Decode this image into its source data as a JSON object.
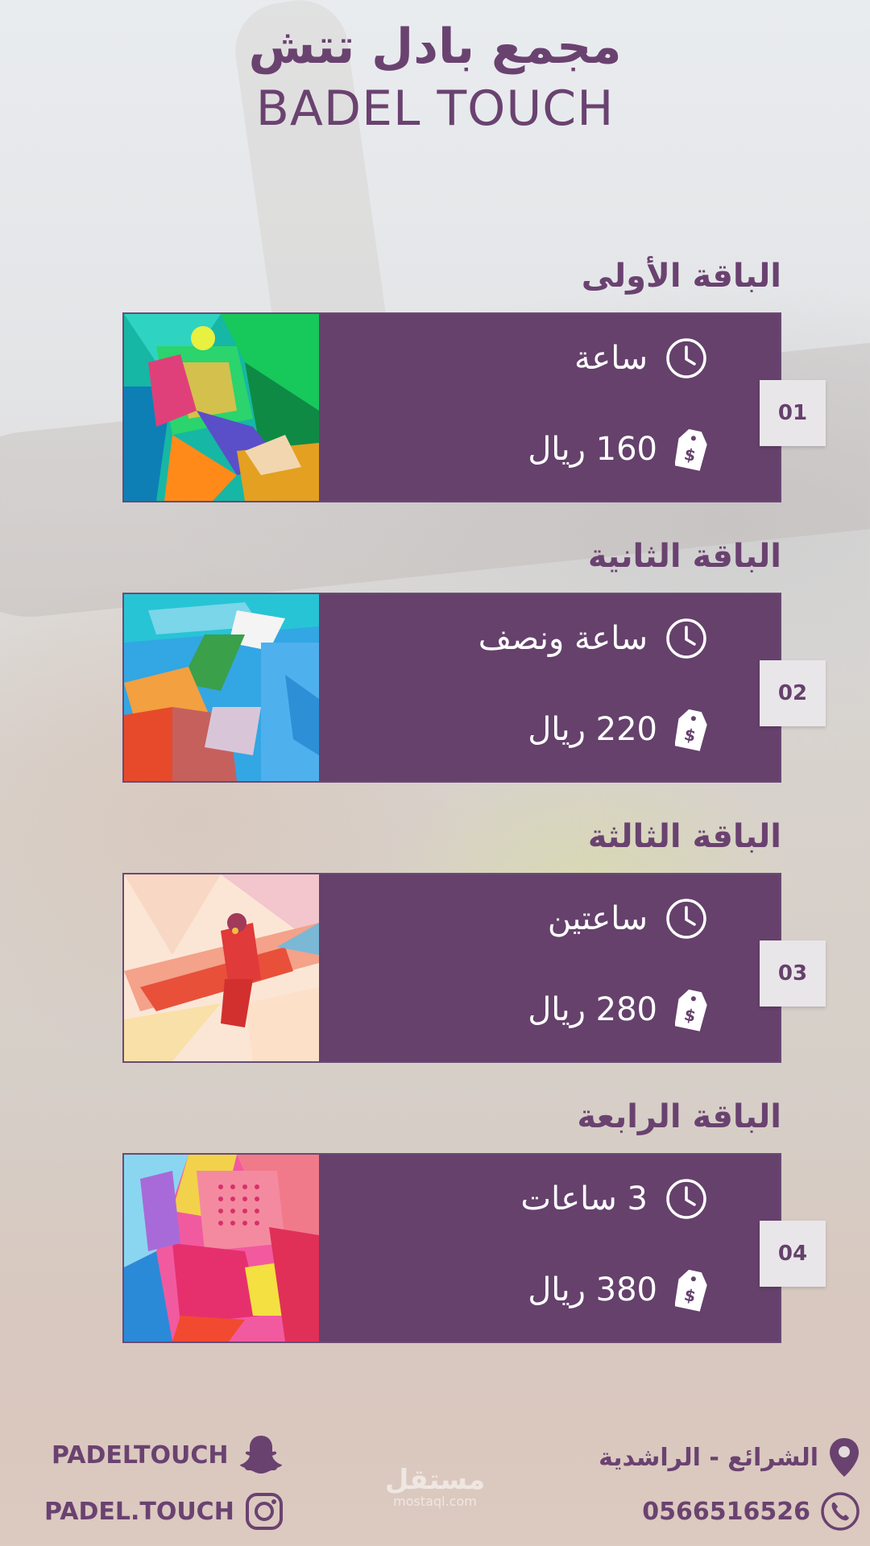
{
  "header": {
    "title_ar": "مجمع بادل تتش",
    "title_en": "BADEL TOUCH"
  },
  "colors": {
    "primary": "#65416c",
    "number_box": "#e9e6e9",
    "text_light": "#ffffff"
  },
  "packages": [
    {
      "title": "الباقة الأولى",
      "duration": "ساعة",
      "price": "160 ريال",
      "number": "01",
      "image": "abstract-padel-racket-ball"
    },
    {
      "title": "الباقة الثانية",
      "duration": "ساعة ونصف",
      "price": "220 ريال",
      "number": "02",
      "image": "abstract-padel-player-arm"
    },
    {
      "title": "الباقة الثالثة",
      "duration": "ساعتين",
      "price": "280 ريال",
      "number": "03",
      "image": "abstract-padel-player-swing"
    },
    {
      "title": "الباقة الرابعة",
      "duration": "3 ساعات",
      "price": "380 ريال",
      "number": "04",
      "image": "abstract-padel-racket-closeup"
    }
  ],
  "icons": {
    "duration": "clock-icon",
    "price": "price-tag-icon",
    "location": "location-pin-icon",
    "phone": "phone-icon",
    "snapchat": "snapchat-icon",
    "instagram": "instagram-icon"
  },
  "footer": {
    "location": "الشرائع - الراشدية",
    "phone": "0566516526",
    "snapchat": "PADELTOUCH",
    "instagram": "PADEL.TOUCH"
  },
  "watermark": {
    "text_ar": "مستقل",
    "text_en": "mostaql.com"
  }
}
